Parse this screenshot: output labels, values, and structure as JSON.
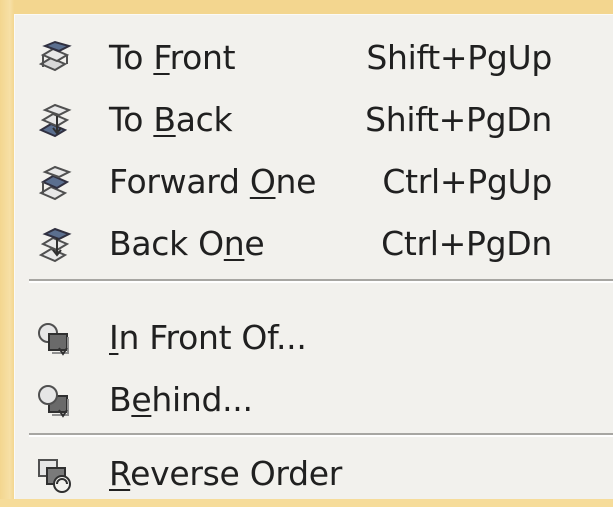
{
  "menu": {
    "items": [
      {
        "prefix": "To ",
        "underline": "F",
        "suffix": "ront",
        "shortcut": "Shift+PgUp",
        "icon": "to-front-icon"
      },
      {
        "prefix": "To ",
        "underline": "B",
        "suffix": "ack",
        "shortcut": "Shift+PgDn",
        "icon": "to-back-icon"
      },
      {
        "prefix": "Forward ",
        "underline": "O",
        "suffix": "ne",
        "shortcut": "Ctrl+PgUp",
        "icon": "forward-one-icon"
      },
      {
        "prefix": "Back O",
        "underline": "n",
        "suffix": "e",
        "shortcut": "Ctrl+PgDn",
        "icon": "back-one-icon"
      },
      {
        "prefix": "",
        "underline": "I",
        "suffix": "n Front Of...",
        "shortcut": "",
        "icon": "in-front-of-icon"
      },
      {
        "prefix": "B",
        "underline": "e",
        "suffix": "hind...",
        "shortcut": "",
        "icon": "behind-icon"
      },
      {
        "prefix": "",
        "underline": "R",
        "suffix": "everse Order",
        "shortcut": "",
        "icon": "reverse-order-icon"
      }
    ]
  },
  "colors": {
    "menu_background": "#f2f1ed",
    "text": "#202020",
    "separator": "#a7a6a2",
    "page_background": "#f6dc9a"
  }
}
